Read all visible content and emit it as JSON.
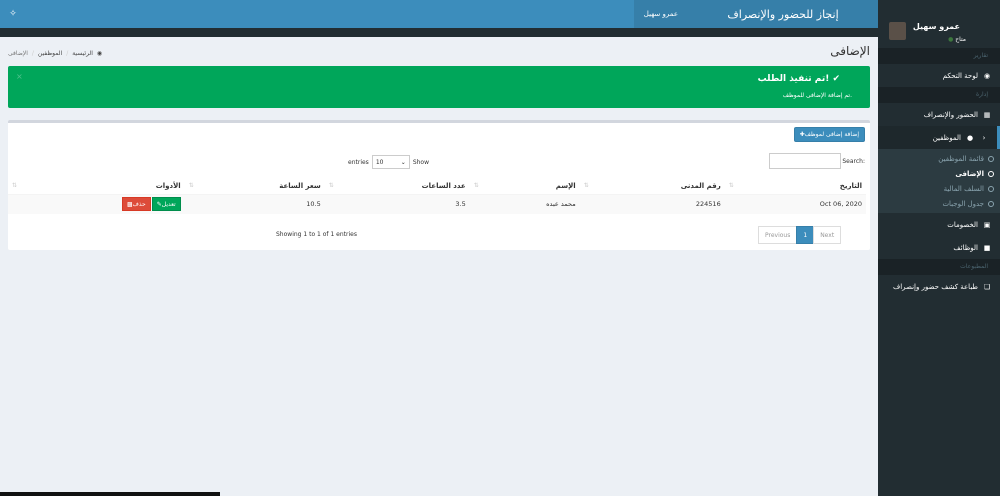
{
  "header": {
    "brand": "إنجاز للحضور والإنصراف",
    "user": "عمرو سهيل"
  },
  "sidebar": {
    "user_name": "عمرو سهيل",
    "user_status": "متاح",
    "section_reports": "تقارير",
    "dashboard": "لوحة التحكم",
    "section_admin": "إدارة",
    "attendance": "الحضور والإنصراف",
    "employees": "الموظفين",
    "submenu": [
      "قائمة الموظفين",
      "الإضافى",
      "السلف المالية",
      "جدول الوجبات"
    ],
    "deductions": "الخصومات",
    "jobs": "الوظائف",
    "section_print": "المطبوعات",
    "print_report": "طباعة كشف حضور وإنصراف"
  },
  "page": {
    "title": "الإضافى",
    "breadcrumb": [
      "الرئيسية",
      "الموظفين",
      "الإضافى"
    ]
  },
  "alert": {
    "title": "تم تنفيذ الطلب!",
    "text": "تم إضافة الإضافى للموظف."
  },
  "toolbar": {
    "add_button": "إضافة إضافى لموظف",
    "search_label": "Search:",
    "show_label": "Show",
    "entries_label": "entries",
    "page_length": "10"
  },
  "table": {
    "columns": [
      "التاريخ",
      "رقم المدنى",
      "الإسم",
      "عدد الساعات",
      "سعر الساعة",
      "الأدوات"
    ],
    "rows": [
      {
        "date": "Oct 06, 2020",
        "civil_id": "224516",
        "name": "محمد عبده",
        "hours": "3.5",
        "rate": "10.5",
        "edit": "تعديل",
        "delete": "حذف"
      }
    ]
  },
  "footer": {
    "info": "Showing 1 to 1 of 1 entries",
    "previous": "Previous",
    "page": "1",
    "next": "Next"
  }
}
